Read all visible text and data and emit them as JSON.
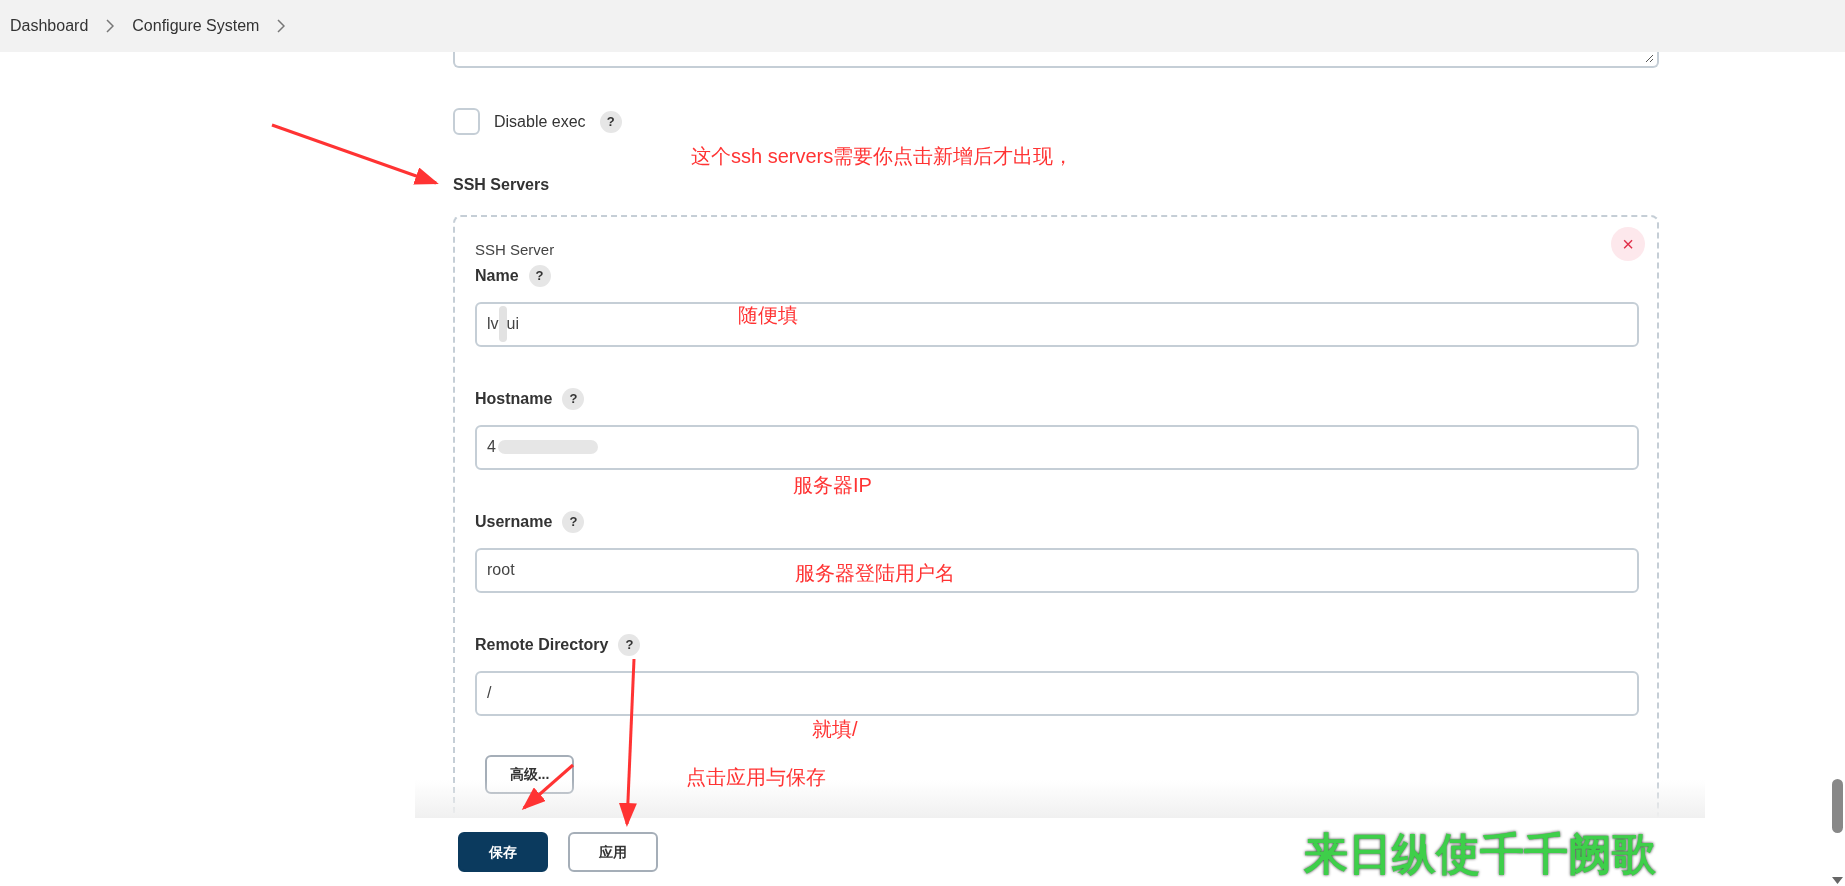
{
  "breadcrumb": [
    {
      "label": "Dashboard"
    },
    {
      "label": "Configure System"
    }
  ],
  "disable_exec": {
    "label": "Disable exec",
    "checked": false,
    "help": "?"
  },
  "section_title": "SSH Servers",
  "server": {
    "title": "SSH Server",
    "close": "×",
    "fields": [
      {
        "label": "Name",
        "help": "?",
        "value": "lv",
        "value_after": "ui"
      },
      {
        "label": "Hostname",
        "help": "?",
        "value": "4"
      },
      {
        "label": "Username",
        "help": "?",
        "value": "root"
      },
      {
        "label": "Remote Directory",
        "help": "?",
        "value": "/"
      }
    ],
    "advanced_button": "高级..."
  },
  "annotations": [
    "这个ssh servers需要你点击新增后才出现，",
    "随便填",
    "服务器IP",
    "服务器登陆用户名",
    "就填/",
    "点击应用与保存"
  ],
  "buttons": [
    {
      "label": "保存",
      "kind": "primary"
    },
    {
      "label": "应用",
      "kind": "secondary"
    }
  ],
  "lyric": "来日纵使千千阙歌"
}
